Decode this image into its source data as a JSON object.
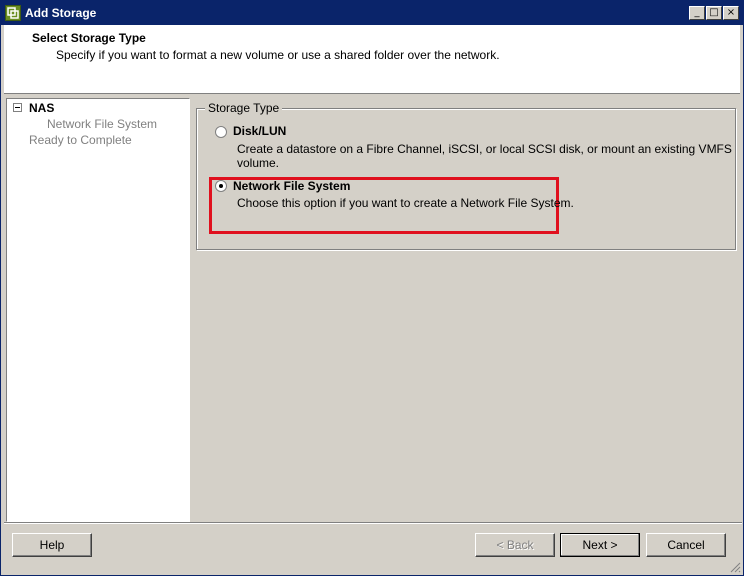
{
  "window": {
    "title": "Add Storage",
    "controls": {
      "minimize": "_",
      "maximize": "□",
      "close": "×"
    }
  },
  "header": {
    "title": "Select Storage Type",
    "subtitle": "Specify if you want to format a new volume or use a shared folder over the network."
  },
  "nav": {
    "root": "NAS",
    "items": [
      "Network File System",
      "Ready to Complete"
    ]
  },
  "storage_type": {
    "legend": "Storage Type",
    "options": [
      {
        "label": "Disk/LUN",
        "description": "Create a datastore on a Fibre Channel, iSCSI, or local SCSI disk, or mount an existing VMFS volume.",
        "selected": false
      },
      {
        "label": "Network File System",
        "description": "Choose this option if you want to create a Network File System.",
        "selected": true
      }
    ]
  },
  "buttons": {
    "help": "Help",
    "back": "< Back",
    "next": "Next >",
    "cancel": "Cancel"
  },
  "colors": {
    "highlight": "#e0101e",
    "titlebar": "#0a246a"
  }
}
